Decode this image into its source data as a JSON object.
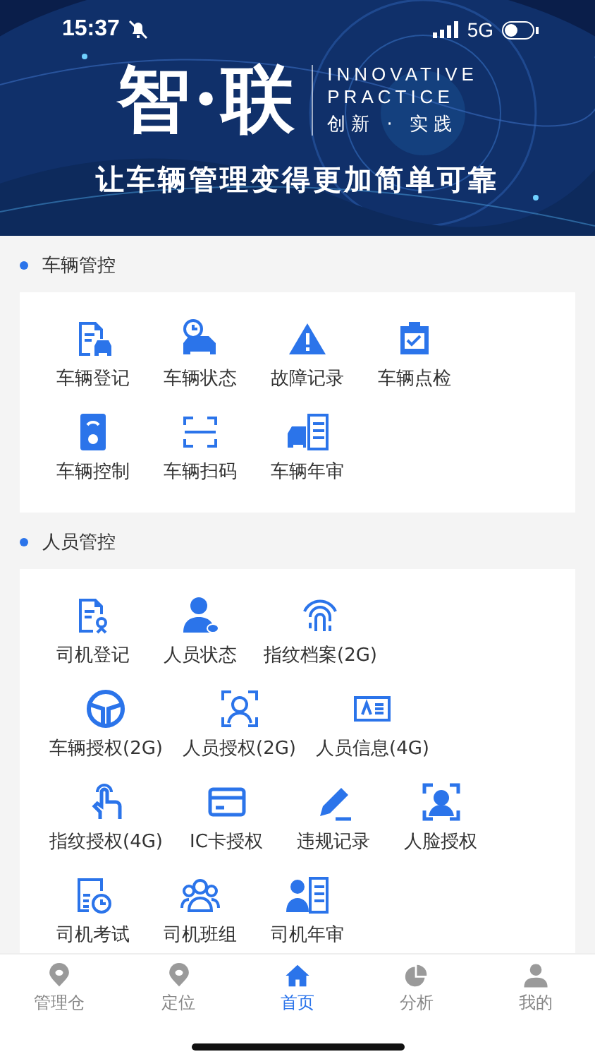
{
  "status_bar": {
    "time": "15:37",
    "network": "5G"
  },
  "banner": {
    "title": "智·联",
    "english_lines": [
      "INNOVATIVE",
      "PRACTICE"
    ],
    "motto": "创新 · 实践",
    "slogan": "让车辆管理变得更加简单可靠"
  },
  "sections": [
    {
      "title": "车辆管控",
      "rows": [
        [
          "车辆登记",
          "车辆状态",
          "故障记录",
          "车辆点检"
        ],
        [
          "车辆控制",
          "车辆扫码",
          "车辆年审"
        ]
      ]
    },
    {
      "title": "人员管控",
      "rows": [
        [
          "司机登记",
          "人员状态",
          "指纹档案(2G)"
        ],
        [
          "车辆授权(2G)",
          "人员授权(2G)",
          "人员信息(4G)"
        ],
        [
          "指纹授权(4G)",
          "IC卡授权",
          "违规记录",
          "人脸授权"
        ],
        [
          "司机考试",
          "司机班组",
          "司机年审"
        ]
      ]
    }
  ],
  "tab_bar": [
    {
      "label": "管理仓",
      "selected": false
    },
    {
      "label": "定位",
      "selected": false
    },
    {
      "label": "首页",
      "selected": true
    },
    {
      "label": "分析",
      "selected": false
    },
    {
      "label": "我的",
      "selected": false
    }
  ]
}
